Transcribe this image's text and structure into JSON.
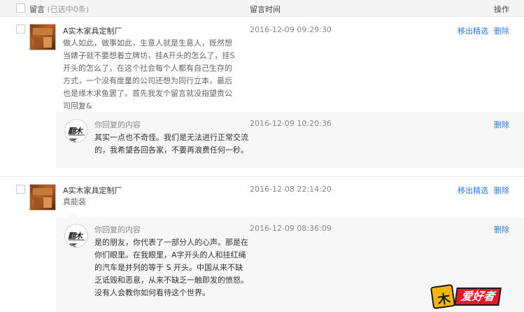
{
  "header": {
    "col_message": "留言",
    "col_message_count": "(已选中0条)",
    "col_time": "留言时间",
    "col_ops": "操作"
  },
  "messages": [
    {
      "author": "A实木家具定制厂",
      "content": "做人如此，做事如此，生意人就是生意人，既然想当婊子就不要想着立牌坊，挂A开头的怎么了，挂S开头的怎么了，在这个社会每个人都有自己生存的方式，一个没有度量的公司还想为同行立本，最后也是缘木求鱼罢了。首先我发个留言就没指望贵公司回复&",
      "time": "2016-12-09 09:29:30",
      "op_feature": "移出精选",
      "op_delete": "删除",
      "reply": {
        "label": "你回复的内容",
        "text": "其实一点也不奇怪。我们是无法进行正常交流的，我希望各回各家，不要再浪费任何一秒。",
        "time": "2016-12-09 10:20:36",
        "op_delete": "删除",
        "avatar_mark": "翻木匠"
      }
    },
    {
      "author": "A实木家具定制厂",
      "content": "真能装",
      "time": "2016-12-08 22:14:20",
      "op_feature": "移出精选",
      "op_delete": "删除",
      "reply": {
        "label": "你回复的内容",
        "text": "是的朋友，你代表了一部分人的心声。那是在你们眼里。在我眼里，A字开头的人和挂红绳的汽车是并列的等于 S 开头。中国从来不缺乏诋毁和恶意，从来不缺乏一触即发的愤怒。没有人会教你如何看待这个世界。",
        "time": "2016-12-09 08:36:09",
        "op_delete": "删除",
        "avatar_mark": "翻木匠"
      }
    }
  ],
  "watermark": {
    "badge": "木",
    "text": "爱好者"
  },
  "colors": {
    "link": "#2b7bd6",
    "header_bg": "#f5f5f5",
    "reply_bg": "#f7f7f7"
  }
}
